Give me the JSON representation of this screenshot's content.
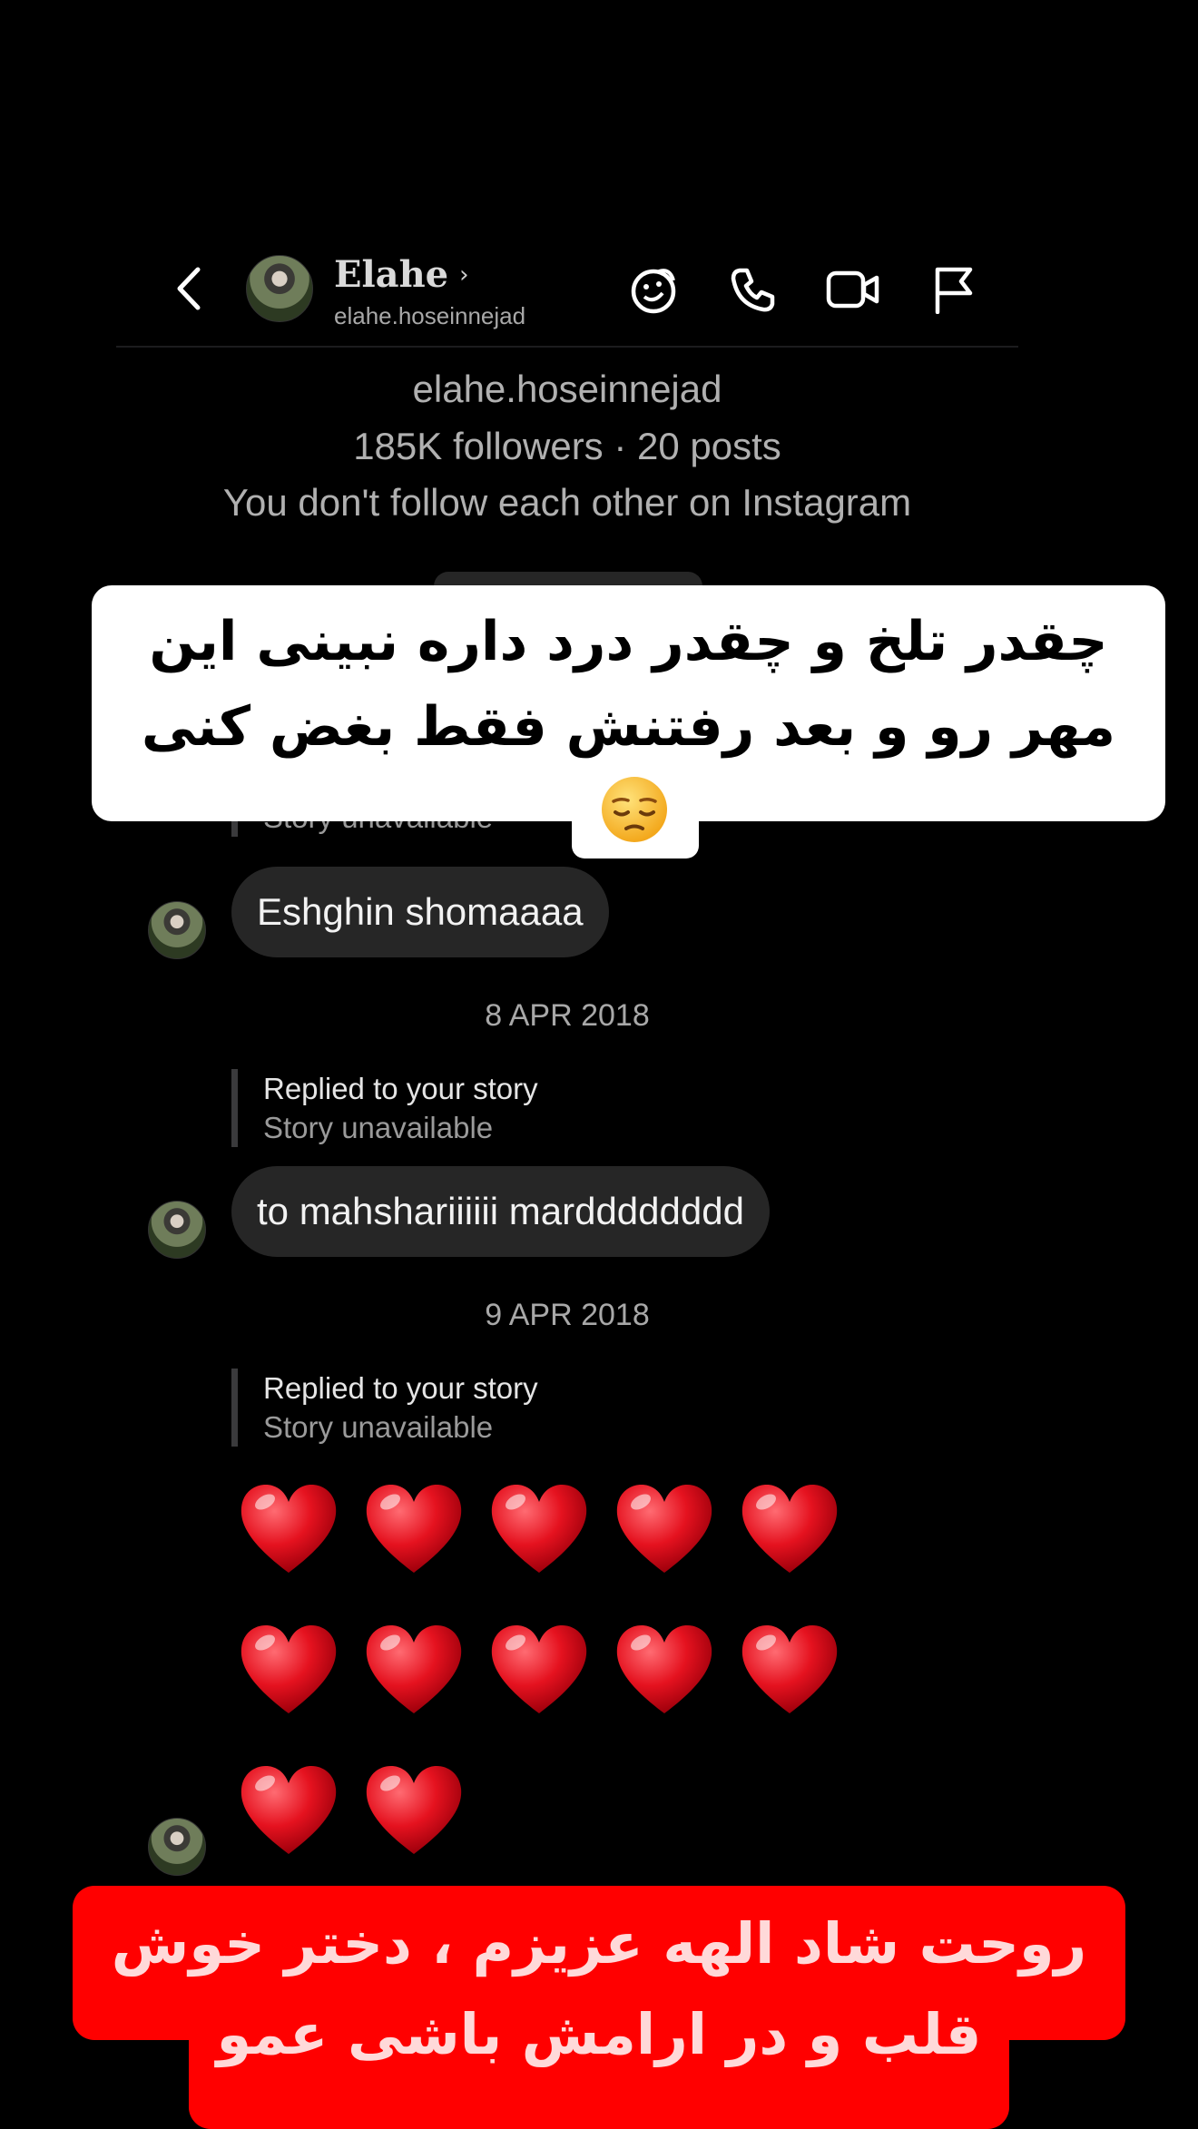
{
  "header": {
    "name": "Elahe",
    "handle": "elahe.hoseinnejad",
    "icons": [
      "back-chevron-icon",
      "sticker-icon",
      "phone-icon",
      "video-icon",
      "flag-icon"
    ]
  },
  "profile": {
    "handle": "elahe.hoseinnejad",
    "stats": "185K followers · 20 posts",
    "follow_status": "You don't follow each other on Instagram"
  },
  "messages": [
    {
      "reply_sub": "Story unavailable",
      "text": "Eshghin shomaaaa"
    },
    {
      "date": "8 APR 2018",
      "reply_title": "Replied to your story",
      "reply_sub": "Story unavailable",
      "text": "to mahshariiiiii mardddddddd"
    },
    {
      "date": "9 APR 2018",
      "reply_title": "Replied to your story",
      "reply_sub": "Story unavailable",
      "hearts": 12
    }
  ],
  "captions": {
    "top": "چقدر تلخ و چقدر درد داره نبینی این مهر رو و بعد رفتنش فقط بغض کنی",
    "top_emoji": "pensive-face-emoji",
    "bottom": "روحت شاد الهه عزیزم ، دختر خوش قلب و در ارامش باشی عمو"
  },
  "colors": {
    "background": "#000000",
    "bubble": "#262626",
    "heart": "#e5121f",
    "caption_top_bg": "#ffffff",
    "caption_bottom_bg": "#ff0000",
    "caption_bottom_text": "#ffd9d9"
  }
}
